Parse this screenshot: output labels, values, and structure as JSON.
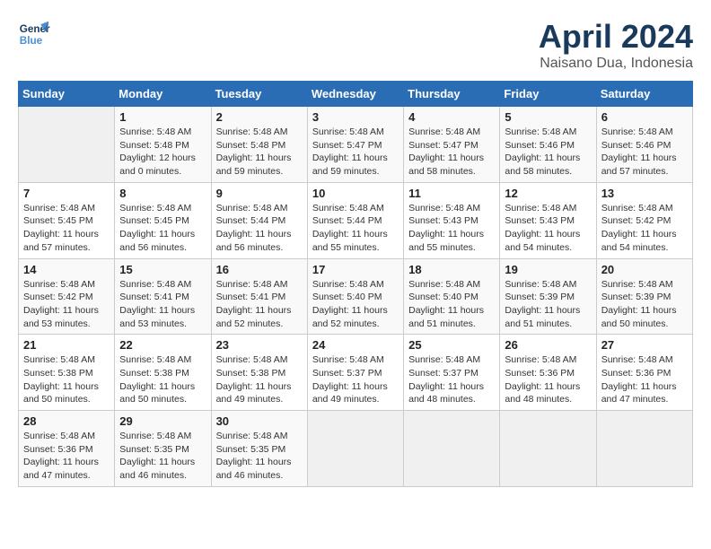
{
  "header": {
    "logo_line1": "General",
    "logo_line2": "Blue",
    "month": "April 2024",
    "location": "Naisano Dua, Indonesia"
  },
  "days_of_week": [
    "Sunday",
    "Monday",
    "Tuesday",
    "Wednesday",
    "Thursday",
    "Friday",
    "Saturday"
  ],
  "weeks": [
    [
      {
        "day": "",
        "info": ""
      },
      {
        "day": "1",
        "info": "Sunrise: 5:48 AM\nSunset: 5:48 PM\nDaylight: 12 hours\nand 0 minutes."
      },
      {
        "day": "2",
        "info": "Sunrise: 5:48 AM\nSunset: 5:48 PM\nDaylight: 11 hours\nand 59 minutes."
      },
      {
        "day": "3",
        "info": "Sunrise: 5:48 AM\nSunset: 5:47 PM\nDaylight: 11 hours\nand 59 minutes."
      },
      {
        "day": "4",
        "info": "Sunrise: 5:48 AM\nSunset: 5:47 PM\nDaylight: 11 hours\nand 58 minutes."
      },
      {
        "day": "5",
        "info": "Sunrise: 5:48 AM\nSunset: 5:46 PM\nDaylight: 11 hours\nand 58 minutes."
      },
      {
        "day": "6",
        "info": "Sunrise: 5:48 AM\nSunset: 5:46 PM\nDaylight: 11 hours\nand 57 minutes."
      }
    ],
    [
      {
        "day": "7",
        "info": "Sunrise: 5:48 AM\nSunset: 5:45 PM\nDaylight: 11 hours\nand 57 minutes."
      },
      {
        "day": "8",
        "info": "Sunrise: 5:48 AM\nSunset: 5:45 PM\nDaylight: 11 hours\nand 56 minutes."
      },
      {
        "day": "9",
        "info": "Sunrise: 5:48 AM\nSunset: 5:44 PM\nDaylight: 11 hours\nand 56 minutes."
      },
      {
        "day": "10",
        "info": "Sunrise: 5:48 AM\nSunset: 5:44 PM\nDaylight: 11 hours\nand 55 minutes."
      },
      {
        "day": "11",
        "info": "Sunrise: 5:48 AM\nSunset: 5:43 PM\nDaylight: 11 hours\nand 55 minutes."
      },
      {
        "day": "12",
        "info": "Sunrise: 5:48 AM\nSunset: 5:43 PM\nDaylight: 11 hours\nand 54 minutes."
      },
      {
        "day": "13",
        "info": "Sunrise: 5:48 AM\nSunset: 5:42 PM\nDaylight: 11 hours\nand 54 minutes."
      }
    ],
    [
      {
        "day": "14",
        "info": "Sunrise: 5:48 AM\nSunset: 5:42 PM\nDaylight: 11 hours\nand 53 minutes."
      },
      {
        "day": "15",
        "info": "Sunrise: 5:48 AM\nSunset: 5:41 PM\nDaylight: 11 hours\nand 53 minutes."
      },
      {
        "day": "16",
        "info": "Sunrise: 5:48 AM\nSunset: 5:41 PM\nDaylight: 11 hours\nand 52 minutes."
      },
      {
        "day": "17",
        "info": "Sunrise: 5:48 AM\nSunset: 5:40 PM\nDaylight: 11 hours\nand 52 minutes."
      },
      {
        "day": "18",
        "info": "Sunrise: 5:48 AM\nSunset: 5:40 PM\nDaylight: 11 hours\nand 51 minutes."
      },
      {
        "day": "19",
        "info": "Sunrise: 5:48 AM\nSunset: 5:39 PM\nDaylight: 11 hours\nand 51 minutes."
      },
      {
        "day": "20",
        "info": "Sunrise: 5:48 AM\nSunset: 5:39 PM\nDaylight: 11 hours\nand 50 minutes."
      }
    ],
    [
      {
        "day": "21",
        "info": "Sunrise: 5:48 AM\nSunset: 5:38 PM\nDaylight: 11 hours\nand 50 minutes."
      },
      {
        "day": "22",
        "info": "Sunrise: 5:48 AM\nSunset: 5:38 PM\nDaylight: 11 hours\nand 50 minutes."
      },
      {
        "day": "23",
        "info": "Sunrise: 5:48 AM\nSunset: 5:38 PM\nDaylight: 11 hours\nand 49 minutes."
      },
      {
        "day": "24",
        "info": "Sunrise: 5:48 AM\nSunset: 5:37 PM\nDaylight: 11 hours\nand 49 minutes."
      },
      {
        "day": "25",
        "info": "Sunrise: 5:48 AM\nSunset: 5:37 PM\nDaylight: 11 hours\nand 48 minutes."
      },
      {
        "day": "26",
        "info": "Sunrise: 5:48 AM\nSunset: 5:36 PM\nDaylight: 11 hours\nand 48 minutes."
      },
      {
        "day": "27",
        "info": "Sunrise: 5:48 AM\nSunset: 5:36 PM\nDaylight: 11 hours\nand 47 minutes."
      }
    ],
    [
      {
        "day": "28",
        "info": "Sunrise: 5:48 AM\nSunset: 5:36 PM\nDaylight: 11 hours\nand 47 minutes."
      },
      {
        "day": "29",
        "info": "Sunrise: 5:48 AM\nSunset: 5:35 PM\nDaylight: 11 hours\nand 46 minutes."
      },
      {
        "day": "30",
        "info": "Sunrise: 5:48 AM\nSunset: 5:35 PM\nDaylight: 11 hours\nand 46 minutes."
      },
      {
        "day": "",
        "info": ""
      },
      {
        "day": "",
        "info": ""
      },
      {
        "day": "",
        "info": ""
      },
      {
        "day": "",
        "info": ""
      }
    ]
  ]
}
